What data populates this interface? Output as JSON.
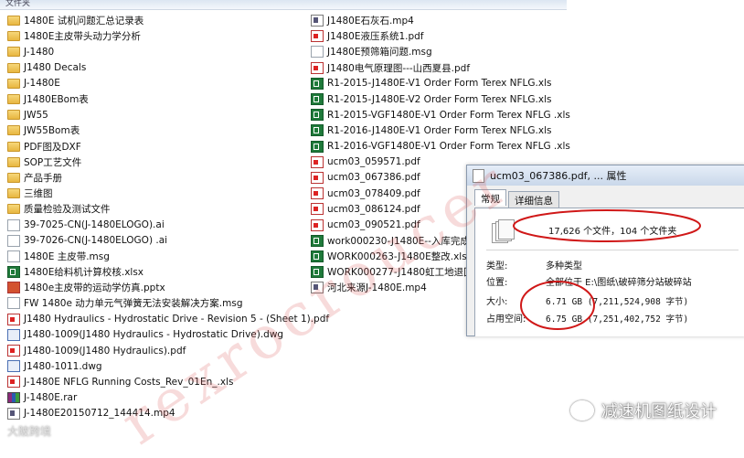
{
  "topbar": {
    "label": "文件夹"
  },
  "left_items": [
    {
      "icon": "folder",
      "name": "1480E 试机问题汇总记录表"
    },
    {
      "icon": "folder",
      "name": "1480E主皮带头动力学分析"
    },
    {
      "icon": "folder",
      "name": "J-1480"
    },
    {
      "icon": "folder",
      "name": "J1480 Decals"
    },
    {
      "icon": "folder",
      "name": "J-1480E"
    },
    {
      "icon": "folder",
      "name": "J1480EBom表"
    },
    {
      "icon": "folder",
      "name": "JW55"
    },
    {
      "icon": "folder",
      "name": "JW55Bom表"
    },
    {
      "icon": "folder",
      "name": "PDF图及DXF"
    },
    {
      "icon": "folder",
      "name": "SOP工艺文件"
    },
    {
      "icon": "folder",
      "name": "产品手册"
    },
    {
      "icon": "folder",
      "name": "三维图"
    },
    {
      "icon": "folder",
      "name": "质量检验及测试文件"
    },
    {
      "icon": "ai",
      "name": "39-7025-CN(J-1480ELOGO).ai"
    },
    {
      "icon": "ai",
      "name": "39-7026-CN(J-1480ELOGO) .ai"
    },
    {
      "icon": "msg",
      "name": "1480E 主皮带.msg"
    },
    {
      "icon": "xls",
      "name": "1480E给料机计算校核.xlsx"
    },
    {
      "icon": "pptx",
      "name": "1480e主皮带的运动学仿真.pptx"
    },
    {
      "icon": "msg",
      "name": "FW  1480e 动力单元气弹簧无法安装解决方案.msg"
    },
    {
      "icon": "pdf",
      "name": "J1480 Hydraulics - Hydrostatic Drive - Revision 5 - (Sheet 1).pdf"
    },
    {
      "icon": "dwg",
      "name": "J1480-1009(J1480 Hydraulics - Hydrostatic Drive).dwg"
    },
    {
      "icon": "pdf",
      "name": "J1480-1009(J1480 Hydraulics).pdf"
    },
    {
      "icon": "dwg",
      "name": "J1480-1011.dwg"
    },
    {
      "icon": "pdf",
      "name": "J-1480E NFLG Running Costs_Rev_01En_.xls"
    },
    {
      "icon": "rar",
      "name": "J-1480E.rar"
    },
    {
      "icon": "mp4",
      "name": "J-1480E20150712_144414.mp4"
    }
  ],
  "right_items": [
    {
      "icon": "mp4",
      "name": "J1480E石灰石.mp4"
    },
    {
      "icon": "pdf",
      "name": "J1480E液压系统1.pdf"
    },
    {
      "icon": "msg",
      "name": "J1480E预筛箱问题.msg"
    },
    {
      "icon": "pdf",
      "name": "J1480电气原理图---山西夏县.pdf"
    },
    {
      "icon": "xls",
      "name": "R1-2015-J1480E-V1 Order Form Terex NFLG.xls"
    },
    {
      "icon": "xls",
      "name": "R1-2015-J1480E-V2 Order Form Terex NFLG.xls"
    },
    {
      "icon": "xls",
      "name": "R1-2015-VGF1480E-V1 Order Form Terex NFLG .xls"
    },
    {
      "icon": "xls",
      "name": "R1-2016-J1480E-V1 Order Form Terex NFLG.xls"
    },
    {
      "icon": "xls",
      "name": "R1-2016-VGF1480E-V1 Order Form Terex NFLG .xls"
    },
    {
      "icon": "pdf",
      "name": "ucm03_059571.pdf"
    },
    {
      "icon": "pdf",
      "name": "ucm03_067386.pdf"
    },
    {
      "icon": "pdf",
      "name": "ucm03_078409.pdf"
    },
    {
      "icon": "pdf",
      "name": "ucm03_086124.pdf"
    },
    {
      "icon": "pdf",
      "name": "ucm03_090521.pdf"
    },
    {
      "icon": "xls",
      "name": "work000230-J1480E--入库完成.xls"
    },
    {
      "icon": "xls",
      "name": "WORK000263-J1480E整改.xls"
    },
    {
      "icon": "xls",
      "name": "WORK000277-J1480虹工地退回.xl"
    },
    {
      "icon": "mp4",
      "name": "河北来源J-1480E.mp4"
    }
  ],
  "dialog": {
    "title": "ucm03_067386.pdf, ... 属性",
    "tabs": [
      "常规",
      "详细信息"
    ],
    "count": "17,626 个文件，104 个文件夹",
    "rows": [
      {
        "k": "类型:",
        "v": "多种类型"
      },
      {
        "k": "位置:",
        "v": "全部位于 E:\\图纸\\破碎筛分站破碎站"
      },
      {
        "k": "大小:",
        "v": "6.71 GB (7,211,524,908 字节)"
      },
      {
        "k": "占用空间:",
        "v": "6.75 GB (7,251,402,752 字节)"
      }
    ]
  },
  "watermark": "rexrocroucer",
  "brand": "减速机图纸设计",
  "corner": "大陂跨境",
  "colors": {
    "circle": "#d01818",
    "folder": "#e8b640"
  }
}
